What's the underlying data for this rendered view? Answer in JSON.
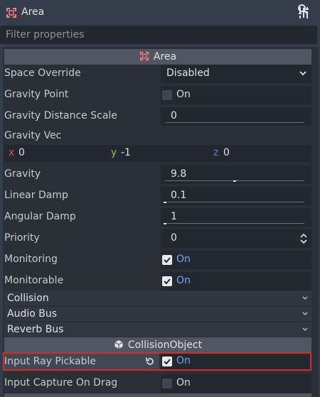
{
  "title_bar": {
    "title": "Area",
    "icon": "area-node-icon",
    "tools_icon": "tools-icon"
  },
  "filter": {
    "placeholder": "Filter properties",
    "value": "",
    "icon": "search-icon"
  },
  "sections": {
    "area": {
      "title": "Area",
      "icon": "area-node-icon"
    },
    "collision_object": {
      "title": "CollisionObject",
      "icon": "cube-icon"
    }
  },
  "properties": {
    "space_override": {
      "label": "Space Override",
      "value": "Disabled"
    },
    "gravity_point": {
      "label": "Gravity Point",
      "checked": false,
      "value": "On"
    },
    "gravity_distance_scale": {
      "label": "Gravity Distance Scale",
      "value": "0"
    },
    "gravity_vec": {
      "label": "Gravity Vec",
      "x_label": "x",
      "x": "0",
      "y_label": "y",
      "y": "-1",
      "z_label": "z",
      "z": "0"
    },
    "gravity": {
      "label": "Gravity",
      "value": "9.8"
    },
    "linear_damp": {
      "label": "Linear Damp",
      "value": "0.1"
    },
    "angular_damp": {
      "label": "Angular Damp",
      "value": "1"
    },
    "priority": {
      "label": "Priority",
      "value": "0"
    },
    "monitoring": {
      "label": "Monitoring",
      "checked": true,
      "value": "On"
    },
    "monitorable": {
      "label": "Monitorable",
      "checked": true,
      "value": "On"
    },
    "input_ray_pickable": {
      "label": "Input Ray Pickable",
      "checked": true,
      "value": "On"
    },
    "input_capture_on_drag": {
      "label": "Input Capture On Drag",
      "checked": false,
      "value": "On"
    }
  },
  "groups": {
    "collision": "Collision",
    "audio_bus": "Audio Bus",
    "reverb_bus": "Reverb Bus"
  },
  "colors": {
    "highlight": "#d12d2d",
    "checked_text": "#6fa7ec",
    "axis_x": "#c25a5a",
    "axis_y": "#8fc25a",
    "axis_z": "#5a86c2"
  }
}
